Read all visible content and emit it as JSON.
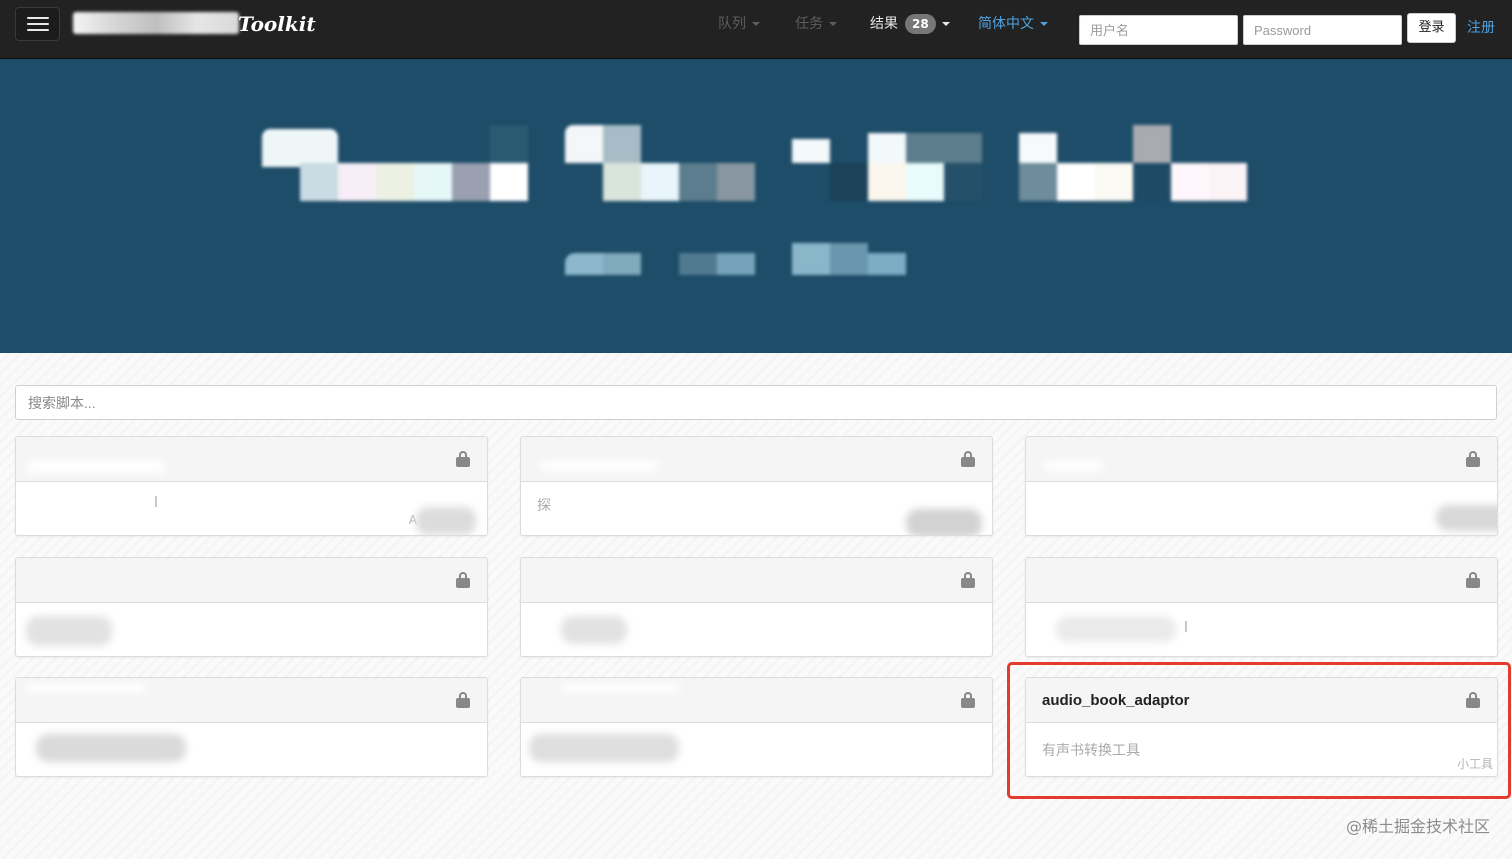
{
  "navbar": {
    "brand_suffix": "Toolkit",
    "menu": {
      "queue": "队列",
      "tasks": "任务",
      "results": "结果",
      "results_count": "28",
      "language": "简体中文"
    },
    "login": {
      "username_placeholder": "用户名",
      "password_placeholder": "Password",
      "login_label": "登录",
      "register_label": "注册"
    }
  },
  "main": {
    "search_placeholder": "搜索脚本...",
    "highlighted_card": {
      "title": "audio_book_adaptor",
      "description": "有声书转换工具",
      "category": "小工具"
    },
    "partial_texts": {
      "card1_desc": "​​l",
      "card1_tag": "A",
      "card2_desc": "探",
      "card6_desc": "l"
    }
  },
  "colors": {
    "navbar_bg": "#222222",
    "hero_bg": "#1e4d69",
    "accent_link": "#4fa3e0",
    "highlight_border": "#e53b2f"
  },
  "icons": {
    "lock": "lock-icon",
    "menu": "hamburger-menu-icon",
    "caret": "caret-down-icon"
  },
  "watermark": "@稀土掘金技术社区"
}
